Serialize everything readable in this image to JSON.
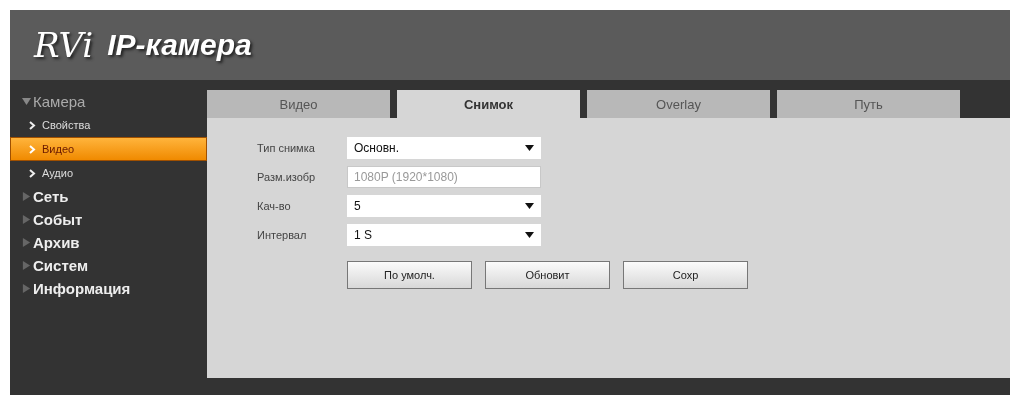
{
  "header": {
    "logo": "RVi",
    "title": "IP-камера"
  },
  "sidebar": {
    "items": [
      {
        "label": "Камера",
        "expanded": true,
        "children": [
          {
            "label": "Свойства",
            "selected": false
          },
          {
            "label": "Видео",
            "selected": true
          },
          {
            "label": "Аудио",
            "selected": false
          }
        ]
      },
      {
        "label": "Сеть",
        "expanded": false
      },
      {
        "label": "Событ",
        "expanded": false
      },
      {
        "label": "Архив",
        "expanded": false
      },
      {
        "label": "Систем",
        "expanded": false
      },
      {
        "label": "Информация",
        "expanded": false
      }
    ]
  },
  "tabs": [
    {
      "label": "Видео",
      "selected": false
    },
    {
      "label": "Снимок",
      "selected": true
    },
    {
      "label": "Overlay",
      "selected": false
    },
    {
      "label": "Путь",
      "selected": false
    }
  ],
  "form": {
    "fields": [
      {
        "label": "Тип снимка",
        "kind": "select",
        "value": "Основн.",
        "disabled": false
      },
      {
        "label": "Разм.изобр",
        "kind": "text",
        "value": "1080P (1920*1080)",
        "disabled": true
      },
      {
        "label": "Кач-во",
        "kind": "select",
        "value": "5",
        "disabled": false
      },
      {
        "label": "Интервал",
        "kind": "select",
        "value": "1 S",
        "disabled": false
      }
    ],
    "buttons": [
      "По умолч.",
      "Обновит",
      "Сохр"
    ]
  }
}
